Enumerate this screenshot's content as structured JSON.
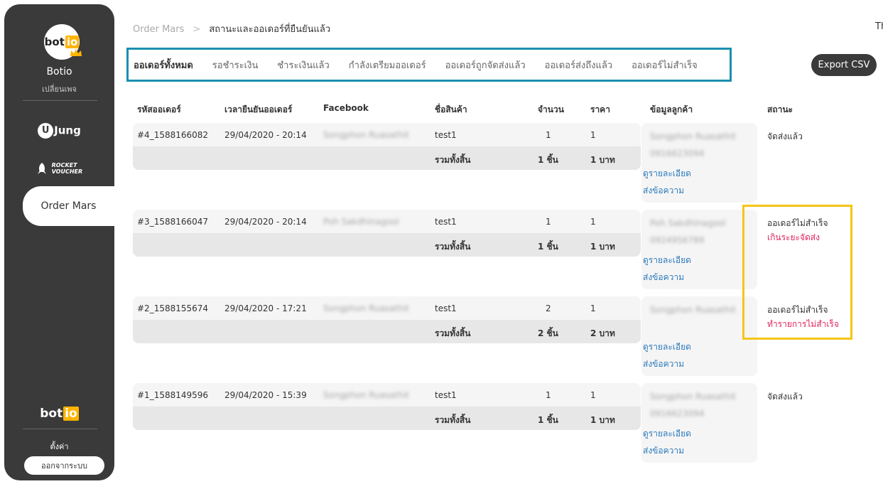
{
  "sidebar": {
    "logo_text": "bot",
    "logo_accent": "io",
    "brand_name": "Botio",
    "switch_page": "เปลี่ยนเพจ",
    "apps": [
      {
        "label": "Jung",
        "badge": "U"
      },
      {
        "label_line1": "ROCKET",
        "label_line2": "VOUCHER"
      },
      {
        "label": "Order Mars"
      }
    ],
    "bottom_logo_text": "bot",
    "bottom_logo_accent": "io",
    "settings": "ตั้งค่า",
    "logout": "ออกจากระบบ"
  },
  "breadcrumb": {
    "root": "Order Mars",
    "separator": ">",
    "current": "สถานะและออเดอร์ที่ยืนยันแล้ว"
  },
  "corner_text": "Th",
  "tabs": [
    {
      "label": "ออเดอร์ทั้งหมด",
      "active": true
    },
    {
      "label": "รอชำระเงิน"
    },
    {
      "label": "ชำระเงินแล้ว"
    },
    {
      "label": "กำลังเตรียมออเดอร์"
    },
    {
      "label": "ออเดอร์ถูกจัดส่งแล้ว"
    },
    {
      "label": "ออเดอร์ส่งถึงแล้ว"
    },
    {
      "label": "ออเดอร์ไม่สำเร็จ"
    }
  ],
  "export_label": "Export CSV",
  "table": {
    "headers": {
      "order_id": "รหัสออเดอร์",
      "confirm_time": "เวลายืนยันออเดอร์",
      "facebook": "Facebook",
      "product": "ชื่อสินค้า",
      "qty": "จำนวน",
      "price": "ราคา",
      "customer": "ข้อมูลลูกค้า",
      "status": "สถานะ"
    },
    "total_label": "รวมทั้งสิ้น",
    "view_details": "ดูรายละเอียด",
    "send_message": "ส่งข้อความ",
    "rows": [
      {
        "order_id": "#4_1588166082",
        "confirm_time": "29/04/2020 - 20:14",
        "facebook": "Songphon Ruasathit",
        "product": "test1",
        "qty": "1",
        "price": "1",
        "total_qty": "1 ชิ้น",
        "total_price": "1 บาท",
        "customer_name": "Songphon Ruasathit",
        "customer_phone": "0916623094",
        "status": "จัดส่งแล้ว",
        "reason": ""
      },
      {
        "order_id": "#3_1588166047",
        "confirm_time": "29/04/2020 - 20:14",
        "facebook": "Poh Sakdhinagool",
        "product": "test1",
        "qty": "1",
        "price": "1",
        "total_qty": "1 ชิ้น",
        "total_price": "1 บาท",
        "customer_name": "Poh Sakdhinagool",
        "customer_phone": "0924956789",
        "status": "ออเดอร์ไม่สำเร็จ",
        "reason": "เกินระยะจัดส่ง"
      },
      {
        "order_id": "#2_1588155674",
        "confirm_time": "29/04/2020 - 17:21",
        "facebook": "Songphon Ruasathit",
        "product": "test1",
        "qty": "2",
        "price": "1",
        "total_qty": "2 ชิ้น",
        "total_price": "2 บาท",
        "customer_name": "Songphon Ruasathit",
        "customer_phone": "",
        "status": "ออเดอร์ไม่สำเร็จ",
        "reason": "ทำรายการไม่สำเร็จ"
      },
      {
        "order_id": "#1_1588149596",
        "confirm_time": "29/04/2020 - 15:39",
        "facebook": "Songphon Ruasathit",
        "product": "test1",
        "qty": "1",
        "price": "1",
        "total_qty": "1 ชิ้น",
        "total_price": "1 บาท",
        "customer_name": "Songphon Ruasathit",
        "customer_phone": "0916623094",
        "status": "จัดส่งแล้ว",
        "reason": ""
      }
    ]
  },
  "colors": {
    "sidebar_bg": "#3a3a3a",
    "tab_highlight": "#1b8fb0",
    "status_highlight": "#f5c518",
    "error_text": "#e0245e",
    "link": "#2b7bbd",
    "logo_accent": "#ffb400"
  }
}
